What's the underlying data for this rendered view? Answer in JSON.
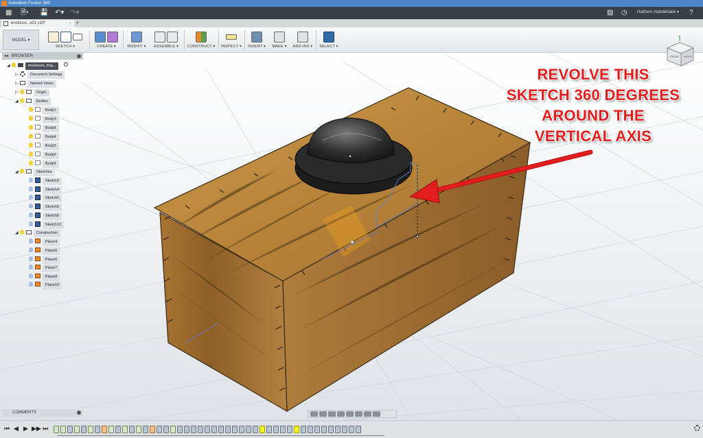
{
  "window": {
    "title": "Autodesk Fusion 360"
  },
  "header": {
    "user_name": "Haithem Abdelkhalek ▾",
    "help": "?"
  },
  "tab": {
    "label": "enclosur...v01 v10*",
    "close": "○",
    "new": "+"
  },
  "workspace": {
    "label": "MODEL ▾"
  },
  "toolbar": {
    "groups": [
      {
        "label": "SKETCH ▾"
      },
      {
        "label": "CREATE ▾"
      },
      {
        "label": "MODIFY ▾"
      },
      {
        "label": "ASSEMBLE ▾"
      },
      {
        "label": "CONSTRUCT ▾"
      },
      {
        "label": "INSPECT ▾"
      },
      {
        "label": "INSERT ▾"
      },
      {
        "label": "MAKE ▾"
      },
      {
        "label": "ADD-INS ▾"
      },
      {
        "label": "SELECT ▾"
      }
    ]
  },
  "browser": {
    "title": "BROWSER",
    "root": "enclosure_fing...",
    "document_settings": "Document Settings",
    "named_views": "Named Views",
    "origin": "Origin",
    "bodies": {
      "label": "Bodies",
      "items": [
        "Body1",
        "Body3",
        "Body8",
        "Body4",
        "Body5",
        "Body6",
        "Body9"
      ]
    },
    "sketches": {
      "label": "Sketches",
      "items": [
        "Sketch3",
        "Sketch4",
        "Sketch5",
        "Sketch6",
        "Sketch8",
        "Sketch13"
      ]
    },
    "construction": {
      "label": "Construction",
      "items": [
        "Plane4",
        "Plane5",
        "Plane6",
        "Plane7",
        "Plane9",
        "Plane10"
      ]
    }
  },
  "comments": {
    "label": "COMMENTS"
  },
  "annotation": {
    "lines": [
      "REVOLVE THIS",
      "SKETCH 360 DEGREES",
      "AROUND THE",
      "VERTICAL AXIS"
    ]
  },
  "colors": {
    "annotation_red": "#e31d1d",
    "titlebar_blue": "#4a86c8",
    "wood": "#b9873c"
  }
}
